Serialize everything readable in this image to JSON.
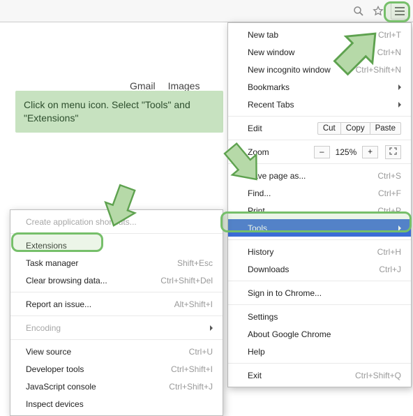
{
  "nav": {
    "gmail": "Gmail",
    "images": "Images"
  },
  "callout": "Click on menu icon. Select \"Tools\" and \"Extensions\"",
  "menu": {
    "newtab": {
      "label": "New tab",
      "shortcut": "Ctrl+T"
    },
    "newwindow": {
      "label": "New window",
      "shortcut": "Ctrl+N"
    },
    "incognito": {
      "label": "New incognito window",
      "shortcut": "Ctrl+Shift+N"
    },
    "bookmarks": {
      "label": "Bookmarks"
    },
    "recent": {
      "label": "Recent Tabs"
    },
    "edit": {
      "label": "Edit",
      "cut": "Cut",
      "copy": "Copy",
      "paste": "Paste"
    },
    "zoom": {
      "label": "Zoom",
      "value": "125%",
      "minus": "–",
      "plus": "+"
    },
    "saveas": {
      "label": "Save page as...",
      "shortcut": "Ctrl+S"
    },
    "find": {
      "label": "Find...",
      "shortcut": "Ctrl+F"
    },
    "print": {
      "label": "Print...",
      "shortcut": "Ctrl+P"
    },
    "tools": {
      "label": "Tools"
    },
    "history": {
      "label": "History",
      "shortcut": "Ctrl+H"
    },
    "downloads": {
      "label": "Downloads",
      "shortcut": "Ctrl+J"
    },
    "signin": {
      "label": "Sign in to Chrome..."
    },
    "settings": {
      "label": "Settings"
    },
    "about": {
      "label": "About Google Chrome"
    },
    "help": {
      "label": "Help"
    },
    "exit": {
      "label": "Exit",
      "shortcut": "Ctrl+Shift+Q"
    }
  },
  "tools_submenu": {
    "createshortcuts": {
      "label": "Create application shortcuts..."
    },
    "extensions": {
      "label": "Extensions"
    },
    "taskmgr": {
      "label": "Task manager",
      "shortcut": "Shift+Esc"
    },
    "clearbrowsing": {
      "label": "Clear browsing data...",
      "shortcut": "Ctrl+Shift+Del"
    },
    "report": {
      "label": "Report an issue...",
      "shortcut": "Alt+Shift+I"
    },
    "encoding": {
      "label": "Encoding"
    },
    "viewsource": {
      "label": "View source",
      "shortcut": "Ctrl+U"
    },
    "devtools": {
      "label": "Developer tools",
      "shortcut": "Ctrl+Shift+I"
    },
    "jsconsole": {
      "label": "JavaScript console",
      "shortcut": "Ctrl+Shift+J"
    },
    "inspect": {
      "label": "Inspect devices"
    }
  }
}
